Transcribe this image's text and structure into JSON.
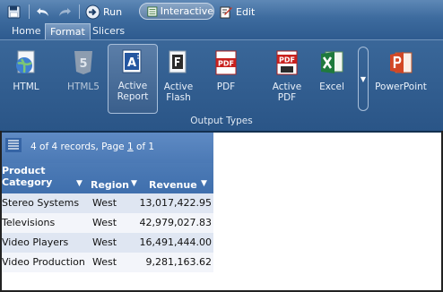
{
  "toolbar": {
    "run_label": "Run",
    "interactive_label": "Interactive",
    "edit_label": "Edit"
  },
  "tabs": [
    {
      "label": "Home",
      "active": false
    },
    {
      "label": "Format",
      "active": true
    },
    {
      "label": "Slicers",
      "active": false
    }
  ],
  "ribbon": {
    "group_label": "Output Types",
    "buttons": [
      {
        "label": "HTML",
        "icon": "html-globe-icon",
        "selected": false,
        "enabled": true
      },
      {
        "label": "HTML5",
        "icon": "html5-icon",
        "selected": false,
        "enabled": false
      },
      {
        "label": "Active Report",
        "icon": "active-report-icon",
        "selected": true,
        "enabled": true
      },
      {
        "label": "Active Flash",
        "icon": "active-flash-icon",
        "selected": false,
        "enabled": true
      },
      {
        "label": "PDF",
        "icon": "pdf-icon",
        "selected": false,
        "enabled": true
      },
      {
        "label": "Active PDF",
        "icon": "active-pdf-icon",
        "selected": false,
        "enabled": true
      },
      {
        "label": "Excel",
        "icon": "excel-icon",
        "selected": false,
        "enabled": true
      },
      {
        "label": "PowerPoint",
        "icon": "powerpoint-icon",
        "selected": false,
        "enabled": true
      }
    ]
  },
  "report": {
    "status_prefix": "4 of 4 records, Page ",
    "page": "1",
    "status_suffix": " of 1",
    "columns": [
      {
        "label": "Product Category"
      },
      {
        "label": "Region"
      },
      {
        "label": "Revenue"
      }
    ],
    "rows": [
      {
        "category": "Stereo Systems",
        "region": "West",
        "revenue": "13,017,422.95"
      },
      {
        "category": "Televisions",
        "region": "West",
        "revenue": "42,979,027.83"
      },
      {
        "category": "Video Players",
        "region": "West",
        "revenue": "16,491,444.00"
      },
      {
        "category": "Video Production",
        "region": "West",
        "revenue": "9,281,163.62"
      }
    ]
  },
  "colors": {
    "ribbon": "#2f5c90",
    "report_header": "#4b79b5",
    "row_odd": "#dfe6f2",
    "row_even": "#f3f5fa"
  }
}
